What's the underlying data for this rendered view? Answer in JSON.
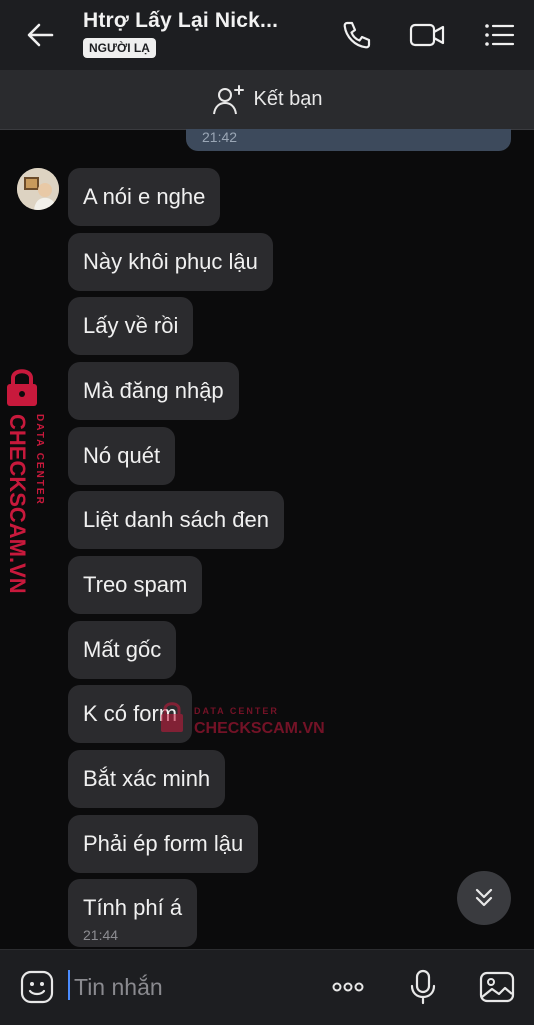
{
  "header": {
    "title": "Htrợ Lấy Lại Nick...",
    "badge": "NGƯỜI LẠ"
  },
  "friend_bar": {
    "label": "Kết bạn"
  },
  "previous_message": {
    "time": "21:42"
  },
  "messages": [
    "A nói e nghe",
    "Này khôi phục lậu",
    "Lấy về rồi",
    "Mà đăng nhập",
    "Nó quét",
    "Liệt danh sách đen",
    "Treo spam",
    "Mất gốc",
    "K có form",
    "Bắt xác minh",
    "Phải ép form lậu",
    "Tính phí á"
  ],
  "last_message_time": "21:44",
  "watermark": {
    "brand": "CHECKSCAM.VN",
    "tag": "DATA CENTER"
  },
  "input": {
    "placeholder": "Tin nhắn"
  },
  "icons": {
    "back": "arrow-left-icon",
    "call": "phone-icon",
    "video": "video-camera-icon",
    "menu": "list-menu-icon",
    "add_friend": "add-person-icon",
    "scroll": "double-chevron-down-icon",
    "sticker": "emoji-sticker-icon",
    "more": "more-dots-icon",
    "voice": "microphone-icon",
    "image": "image-icon"
  },
  "colors": {
    "background": "#0b0b0c",
    "bubble": "#2b2b2e",
    "header": "#1d1e21",
    "accent": "#4a8cff",
    "watermark": "#c8193c"
  }
}
